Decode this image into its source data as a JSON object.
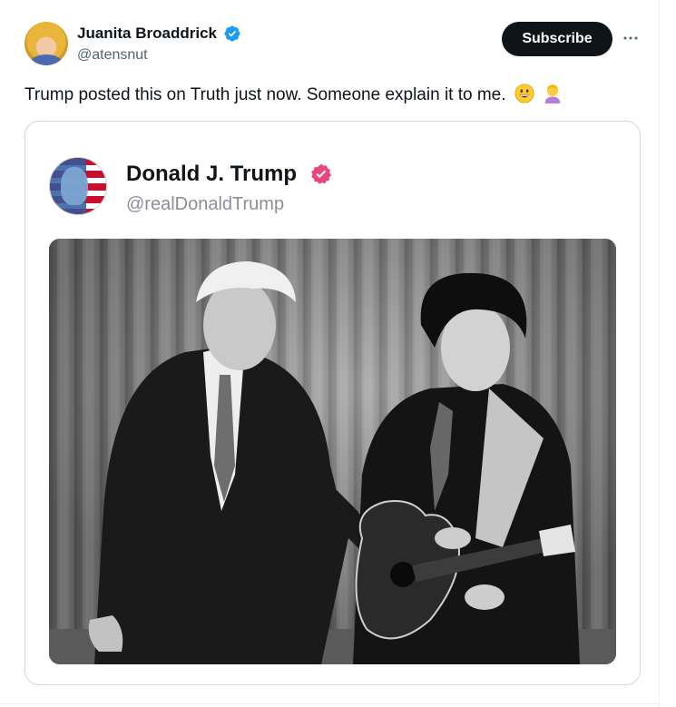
{
  "author": {
    "name": "Juanita Broaddrick",
    "handle": "@atensnut"
  },
  "actions": {
    "subscribe_label": "Subscribe"
  },
  "tweet": {
    "text": "Trump posted this on Truth just now. Someone explain it to me."
  },
  "quoted_post": {
    "name": "Donald J. Trump",
    "handle": "@realDonaldTrump",
    "image_caption_visible": ""
  },
  "colors": {
    "verified_blue": "#1d9bf0",
    "truth_badge": "#e8467c",
    "subscribe_bg": "#0f1419",
    "handle_gray": "#536471"
  },
  "icons": [
    "verified-badge-icon",
    "more-options-icon",
    "grinning-face-emoji",
    "person-facepalming-emoji",
    "truth-verified-icon"
  ]
}
